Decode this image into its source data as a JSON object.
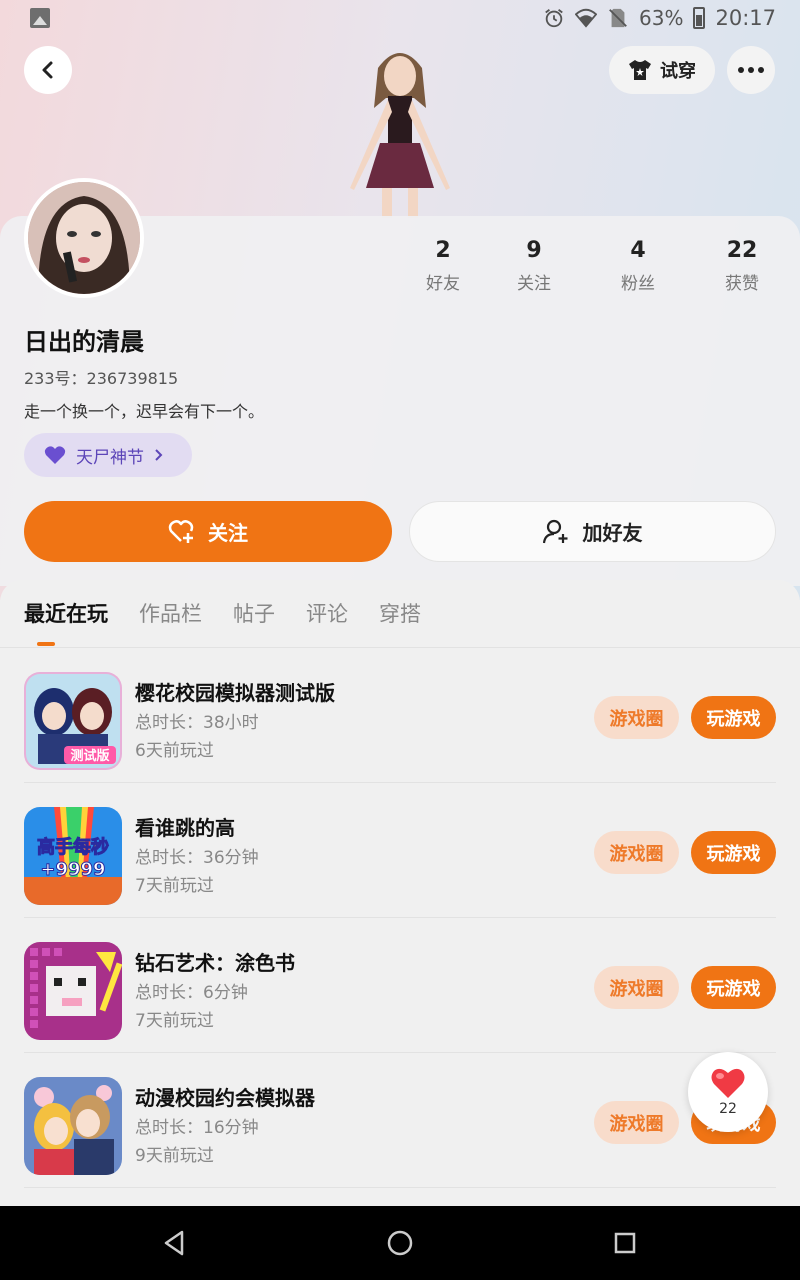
{
  "status_bar": {
    "battery": "63%",
    "time": "20:17",
    "icons": [
      "gallery-icon",
      "alarm-icon",
      "wifi-icon",
      "no-sim-icon",
      "battery-icon"
    ]
  },
  "header": {
    "back_icon": "chevron-left-icon",
    "tryon_label": "试穿",
    "tryon_icon": "shirt-icon",
    "more_icon": "more-dots-icon"
  },
  "profile": {
    "nickname": "日出的清晨",
    "uid": "233号：236739815",
    "bio": "走一个换一个，迟早会有下一个。",
    "badge_label": "天尸神节",
    "stats": [
      {
        "num": "2",
        "label": "好友"
      },
      {
        "num": "9",
        "label": "关注"
      },
      {
        "num": "4",
        "label": "粉丝"
      },
      {
        "num": "22",
        "label": "获赞"
      }
    ]
  },
  "actions": {
    "follow_label": "关注",
    "add_friend_label": "加好友"
  },
  "tabs": [
    "最近在玩",
    "作品栏",
    "帖子",
    "评论",
    "穿搭"
  ],
  "games": [
    {
      "title": "樱花校园模拟器测试版",
      "time": "总时长：38小时",
      "last": "6天前玩过",
      "circle": "游戏圈",
      "play": "玩游戏",
      "icon_text": "测试版"
    },
    {
      "title": "看谁跳的高",
      "time": "总时长：36分钟",
      "last": "7天前玩过",
      "circle": "游戏圈",
      "play": "玩游戏",
      "icon_text": "高手每秒\n+9999"
    },
    {
      "title": "钻石艺术：涂色书",
      "time": "总时长：6分钟",
      "last": "7天前玩过",
      "circle": "游戏圈",
      "play": "玩游戏",
      "icon_text": ""
    },
    {
      "title": "动漫校园约会模拟器",
      "time": "总时长：16分钟",
      "last": "9天前玩过",
      "circle": "游戏圈",
      "play": "玩游戏",
      "icon_text": ""
    }
  ],
  "like_float": {
    "count": "22"
  },
  "colors": {
    "accent": "#f07414",
    "badge_bg": "#e2dcf2",
    "badge_text": "#5c45b8",
    "circle_bg": "#f8dccb"
  }
}
